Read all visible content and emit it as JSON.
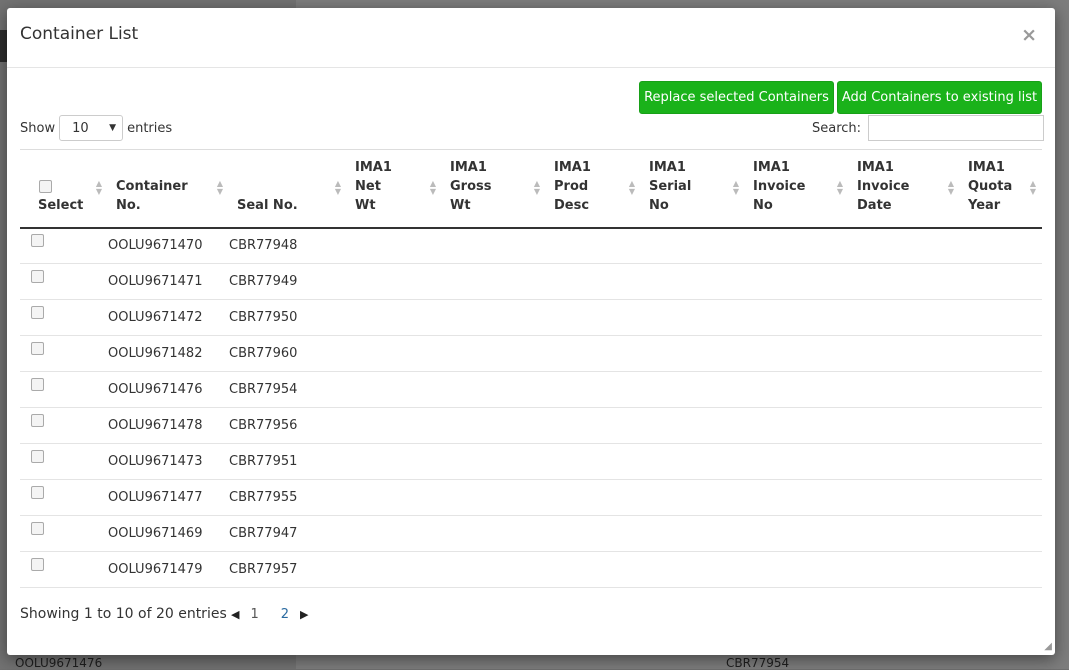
{
  "modal": {
    "title": "Container List",
    "close_glyph": "×",
    "replace_button": "Replace selected Containers",
    "add_button": "Add Containers to existing list"
  },
  "length": {
    "show_label": "Show",
    "value": "10",
    "entries_label": "entries"
  },
  "search": {
    "label": "Search:",
    "value": ""
  },
  "table": {
    "headers": [
      "Select",
      "Container No.",
      "Seal No.",
      "IMA1 Net Wt",
      "IMA1 Gross Wt",
      "IMA1 Prod Desc",
      "IMA1 Serial No",
      "IMA1 Invoice No",
      "IMA1 Invoice Date",
      "IMA1 Quota Year"
    ],
    "rows": [
      {
        "container": "OOLU9671470",
        "seal": "CBR77948"
      },
      {
        "container": "OOLU9671471",
        "seal": "CBR77949"
      },
      {
        "container": "OOLU9671472",
        "seal": "CBR77950"
      },
      {
        "container": "OOLU9671482",
        "seal": "CBR77960"
      },
      {
        "container": "OOLU9671476",
        "seal": "CBR77954"
      },
      {
        "container": "OOLU9671478",
        "seal": "CBR77956"
      },
      {
        "container": "OOLU9671473",
        "seal": "CBR77951"
      },
      {
        "container": "OOLU9671477",
        "seal": "CBR77955"
      },
      {
        "container": "OOLU9671469",
        "seal": "CBR77947"
      },
      {
        "container": "OOLU9671479",
        "seal": "CBR77957"
      }
    ]
  },
  "info": "Showing 1 to 10 of 20 entries",
  "pagination": {
    "pages": [
      "1",
      "2"
    ],
    "current": "2"
  },
  "background": {
    "bottom_left_text": "OOLU9671476",
    "bottom_right_text": "CBR77954"
  },
  "colors": {
    "button_green": "#1ab21a",
    "current_page": "#2a6aa0"
  }
}
